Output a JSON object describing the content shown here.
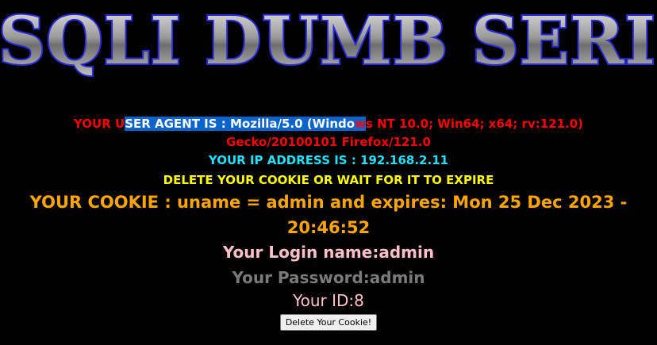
{
  "banner": {
    "title": "SQLI DUMB SERIES"
  },
  "user_agent": {
    "prefix": "YOUR U",
    "selected": "SER AGENT IS : Mozilla/5.0 (Windo",
    "selected_tail": "w",
    "rest_line1": "s NT 10.0; Win64; x64; rv:121.0)",
    "line2": "Gecko/20100101 Firefox/121.0"
  },
  "ip": "YOUR IP ADDRESS IS : 192.168.2.11",
  "delete_notice": "DELETE YOUR COOKIE OR WAIT FOR IT TO EXPIRE",
  "cookie": {
    "line1": "YOUR COOKIE : uname = admin and expires: Mon 25 Dec 2023 -",
    "line2": "20:46:52"
  },
  "login_name": "Your Login name:admin",
  "password": "Your Password:admin",
  "user_id": "Your ID:8",
  "delete_button": "Delete Your Cookie!",
  "colors": {
    "background": "#000000",
    "red": "#ff0000",
    "cyan": "#22e0ff",
    "yellow": "#ffff00",
    "orange": "#ffa500",
    "pink": "#ffc0cb",
    "grey": "#7a7a7a",
    "selection": "#0a64cc"
  }
}
